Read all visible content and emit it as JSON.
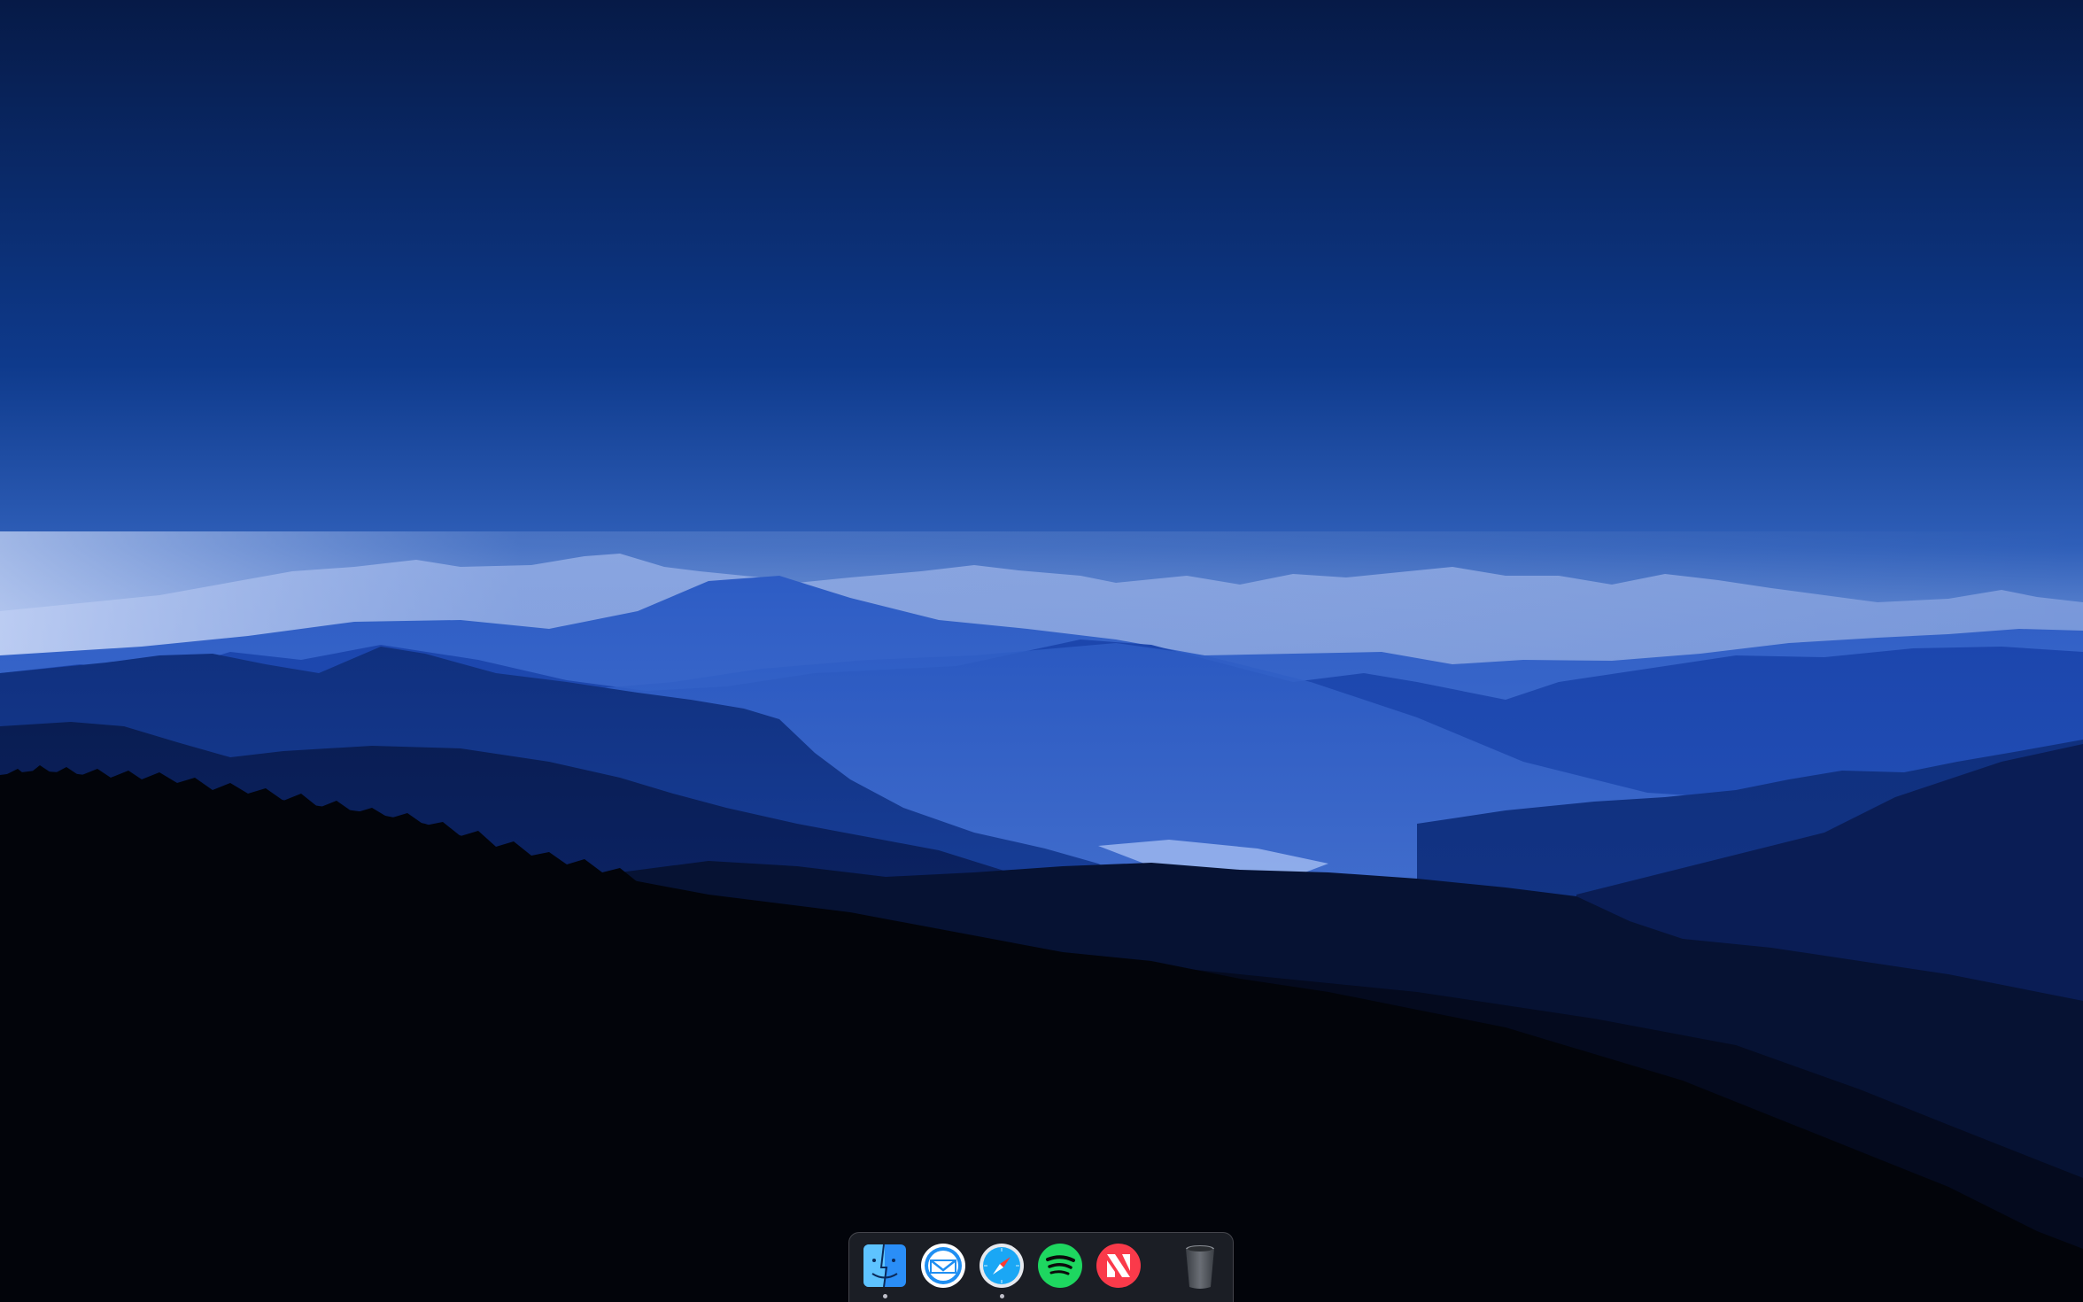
{
  "desktop": {
    "wallpaper": "blue-mountain-range",
    "colors": {
      "sky_top": "#061a47",
      "sky_mid": "#0f3f9a",
      "sky_horizon": "#8aa9e6",
      "foreground": "#02040a"
    }
  },
  "dock": {
    "apps": [
      {
        "id": "finder",
        "icon": "finder-icon",
        "running": true
      },
      {
        "id": "airmail",
        "icon": "airmail-icon",
        "running": false
      },
      {
        "id": "safari",
        "icon": "safari-icon",
        "running": true
      },
      {
        "id": "spotify",
        "icon": "spotify-icon",
        "running": false
      },
      {
        "id": "news",
        "icon": "news-icon",
        "running": false
      }
    ],
    "trash": {
      "icon": "trash-icon",
      "empty": true
    }
  }
}
